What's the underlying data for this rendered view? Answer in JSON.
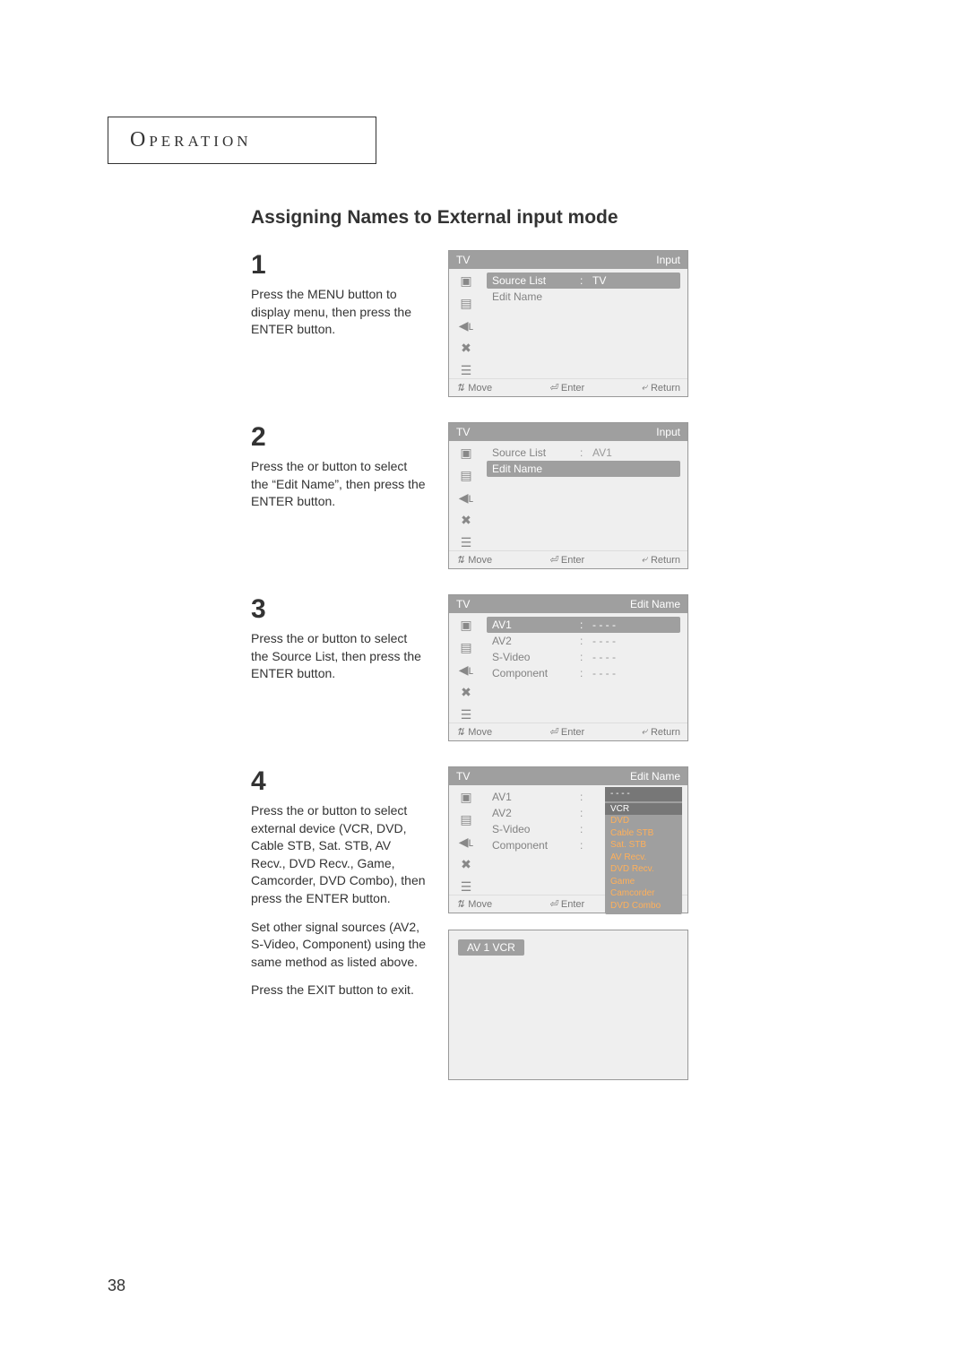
{
  "header_tab": "Operation",
  "section_title": "Assigning Names to External input mode",
  "page_number": "38",
  "footer_hints": {
    "move": "Move",
    "enter": "Enter",
    "return": "Return"
  },
  "steps": [
    {
      "num": "1",
      "text": [
        "Press the MENU button to display menu, then press the ENTER button."
      ],
      "osd": {
        "hl": "TV",
        "hr": "Input",
        "rows": [
          {
            "lab": "Source List",
            "sep": ":",
            "val": "TV",
            "hl": true
          },
          {
            "lab": "Edit Name",
            "sep": "",
            "val": "",
            "hl": false
          }
        ]
      }
    },
    {
      "num": "2",
      "text": [
        "Press the      or      button to select the “Edit Name”, then press the ENTER button."
      ],
      "osd": {
        "hl": "TV",
        "hr": "Input",
        "rows": [
          {
            "lab": "Source List",
            "sep": ":",
            "val": "AV1",
            "hl": false
          },
          {
            "lab": "Edit Name",
            "sep": "",
            "val": "",
            "hl": true
          }
        ]
      }
    },
    {
      "num": "3",
      "text": [
        "Press the      or      button to select the Source List, then press the ENTER button."
      ],
      "osd": {
        "hl": "TV",
        "hr": "Edit Name",
        "rows": [
          {
            "lab": "AV1",
            "sep": ":",
            "val": "- - - -",
            "hl": true
          },
          {
            "lab": "AV2",
            "sep": ":",
            "val": "- - - -",
            "hl": false
          },
          {
            "lab": "S-Video",
            "sep": ":",
            "val": "- - - -",
            "hl": false
          },
          {
            "lab": "Component",
            "sep": ":",
            "val": "- - - -",
            "hl": false
          }
        ]
      }
    },
    {
      "num": "4",
      "text": [
        "Press the      or      button to select external device (VCR, DVD, Cable STB, Sat. STB, AV Recv., DVD Recv., Game, Camcorder, DVD Combo), then press the ENTER button.",
        "Set other signal sources (AV2, S-Video, Component) using the same method as listed above.",
        "Press the EXIT button to exit."
      ],
      "osd": {
        "hl": "TV",
        "hr": "Edit Name",
        "rows": [
          {
            "lab": "AV1",
            "sep": ":",
            "val": "",
            "hl": false
          },
          {
            "lab": "AV2",
            "sep": ":",
            "val": "",
            "hl": false
          },
          {
            "lab": "S-Video",
            "sep": ":",
            "val": "",
            "hl": false
          },
          {
            "lab": "Component",
            "sep": ":",
            "val": "",
            "hl": false
          }
        ],
        "popup": {
          "first": "- - - -",
          "sel": "VCR",
          "rest": [
            "DVD",
            "Cable STB",
            "Sat. STB",
            "AV Recv.",
            "DVD Recv.",
            "Game",
            "Camcorder",
            "DVD Combo"
          ]
        }
      },
      "osd_result": "AV 1   VCR"
    }
  ],
  "icon_glyphs": {
    "tv": "▣",
    "picture": "▤",
    "sound": "◀ʟ",
    "setup": "✖",
    "sliders": "☰",
    "updown": "⇅",
    "enter": "⏎",
    "return": "⤶"
  }
}
